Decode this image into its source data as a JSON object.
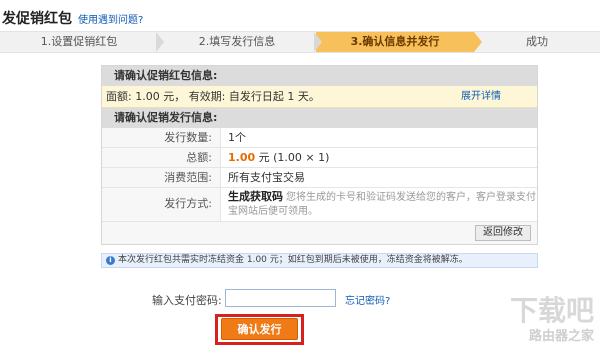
{
  "header": {
    "title": "发促销红包",
    "help_link": "使用遇到问题?"
  },
  "steps": [
    {
      "label": "1.设置促销红包"
    },
    {
      "label": "2.填写发行信息"
    },
    {
      "label": "3.确认信息并发行"
    },
    {
      "label": "成功"
    }
  ],
  "confirm_packet": {
    "heading": "请确认促销红包信息:",
    "summary": "面额: 1.00 元， 有效期: 自发行日起 1 天。",
    "detail_link": "展开详情"
  },
  "confirm_issue": {
    "heading": "请确认促销发行信息:",
    "rows": [
      {
        "label": "发行数量:",
        "value": "1个"
      },
      {
        "label": "总额:",
        "value_amount": "1.00",
        "value_unit": " 元 (1.00 × 1)"
      },
      {
        "label": "消费范围:",
        "value": "所有支付宝交易"
      },
      {
        "label": "发行方式:",
        "value_title": "生成获取码",
        "value_desc": "您将生成的卡号和验证码发送给您的客户，客户登录支付宝网站后便可领用。"
      }
    ],
    "back_button": "返回修改"
  },
  "notice": {
    "text": "本次发行红包共需实时冻结资金 1.00 元；如红包到期后未被使用，冻结资金将被解冻。"
  },
  "payment": {
    "password_label": "输入支付密码:",
    "password_value": "",
    "forgot_link": "忘记密码?"
  },
  "submit_button": "确认发行",
  "watermark": {
    "logo": "下载吧",
    "text": "路由器之家"
  },
  "colors": {
    "active_step": "#f8c05a",
    "submit": "#f07a16",
    "highlight_box": "#d8211e",
    "link": "#0f5bb5",
    "amount": "#e46c00"
  }
}
